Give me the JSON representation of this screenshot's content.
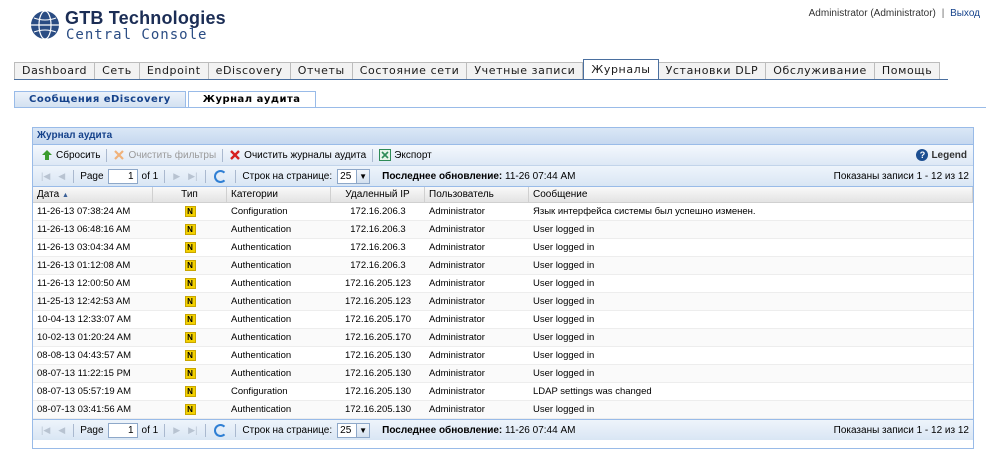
{
  "header": {
    "logo_title": "GTB Technologies",
    "logo_subtitle": "Central Console",
    "user": "Administrator (Administrator)",
    "separator": "|",
    "logout": "Выход"
  },
  "main_tabs": [
    "Dashboard",
    "Сеть",
    "Endpoint",
    "eDiscovery",
    "Отчеты",
    "Состояние сети",
    "Учетные записи",
    "Журналы",
    "Установки DLP",
    "Обслуживание",
    "Помощь"
  ],
  "active_main_tab": "Журналы",
  "sub_tabs": [
    "Сообщения eDiscovery",
    "Журнал аудита"
  ],
  "active_sub_tab": "Журнал аудита",
  "panel": {
    "title": "Журнал аудита",
    "toolbar": {
      "reset": "Сбросить",
      "clear_filters": "Очистить фильтры",
      "clear_logs": "Очистить журналы аудита",
      "export": "Экспорт",
      "legend": "Legend"
    },
    "pager": {
      "page_label": "Page",
      "page_value": "1",
      "of_label": "of 1",
      "rows_label": "Строк на странице:",
      "rows_value": "25",
      "last_update_label": "Последнее обновление:",
      "last_update_value": "11-26 07:44 AM",
      "records": "Показаны записи 1 - 12 из 12"
    },
    "columns": [
      "Дата",
      "Тип",
      "Категории",
      "Удаленный IP",
      "Пользователь",
      "Сообщение"
    ],
    "sort_indicator": "▲",
    "rows": [
      {
        "date": "11-26-13 07:38:24 AM",
        "type": "N",
        "category": "Configuration",
        "ip": "172.16.206.3",
        "user": "Administrator",
        "message": "Язык интерфейса системы был успешно изменен."
      },
      {
        "date": "11-26-13 06:48:16 AM",
        "type": "N",
        "category": "Authentication",
        "ip": "172.16.206.3",
        "user": "Administrator",
        "message": "User logged in"
      },
      {
        "date": "11-26-13 03:04:34 AM",
        "type": "N",
        "category": "Authentication",
        "ip": "172.16.206.3",
        "user": "Administrator",
        "message": "User logged in"
      },
      {
        "date": "11-26-13 01:12:08 AM",
        "type": "N",
        "category": "Authentication",
        "ip": "172.16.206.3",
        "user": "Administrator",
        "message": "User logged in"
      },
      {
        "date": "11-26-13 12:00:50 AM",
        "type": "N",
        "category": "Authentication",
        "ip": "172.16.205.123",
        "user": "Administrator",
        "message": "User logged in"
      },
      {
        "date": "11-25-13 12:42:53 AM",
        "type": "N",
        "category": "Authentication",
        "ip": "172.16.205.123",
        "user": "Administrator",
        "message": "User logged in"
      },
      {
        "date": "10-04-13 12:33:07 AM",
        "type": "N",
        "category": "Authentication",
        "ip": "172.16.205.170",
        "user": "Administrator",
        "message": "User logged in"
      },
      {
        "date": "10-02-13 01:20:24 AM",
        "type": "N",
        "category": "Authentication",
        "ip": "172.16.205.170",
        "user": "Administrator",
        "message": "User logged in"
      },
      {
        "date": "08-08-13 04:43:57 AM",
        "type": "N",
        "category": "Authentication",
        "ip": "172.16.205.130",
        "user": "Administrator",
        "message": "User logged in"
      },
      {
        "date": "08-07-13 11:22:15 PM",
        "type": "N",
        "category": "Authentication",
        "ip": "172.16.205.130",
        "user": "Administrator",
        "message": "User logged in"
      },
      {
        "date": "08-07-13 05:57:19 AM",
        "type": "N",
        "category": "Configuration",
        "ip": "172.16.205.130",
        "user": "Administrator",
        "message": "LDAP settings was changed"
      },
      {
        "date": "08-07-13 03:41:56 AM",
        "type": "N",
        "category": "Authentication",
        "ip": "172.16.205.130",
        "user": "Administrator",
        "message": "User logged in"
      }
    ]
  },
  "colors": {
    "accent": "#15428b",
    "panel_border": "#99bbe8",
    "badge_normal": "#f3d100",
    "icon_reset": "#3b9b2e",
    "icon_clear_logs": "#d62020",
    "icon_export": "#2e8b57"
  },
  "icons": {
    "reset": "green-arrow-icon",
    "clear_filters": "orange-x-icon",
    "clear_logs": "red-x-icon",
    "export": "excel-icon",
    "legend": "question-icon",
    "refresh": "refresh-icon"
  }
}
